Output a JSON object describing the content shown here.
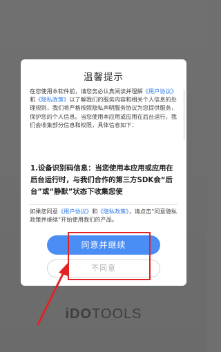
{
  "app": {
    "logo_mark": "iDO",
    "logo_rest": "TOOLS"
  },
  "dialog": {
    "title": "温馨提示",
    "intro": {
      "text_1": "在您使用本软件前，请您务必认真阅读并理解",
      "link_user_agreement": "《用户协议》",
      "text_2": "和",
      "link_privacy_policy": "《隐私政策》",
      "text_3": "以了解我们的服务内容和相关个人信息的处理规则，我们将严格按照隐私声明服务协议为您提供服务，保护您的个人信息。当您使用本应用或应用在后台运行，我们会收集部分信息和权限，具体信息如下："
    },
    "section_heading": "1.设备识别码信息：当您使用本应用或应用在后台运行时，与我们合作的第三方SDK会“后台”或“静默”状态下收集您使",
    "consent": {
      "text_1": "如果您同意",
      "link_user_agreement": "《用户协议》",
      "text_2": "和",
      "link_privacy_policy": "《隐私政策》",
      "text_3": "，请点击“同意隐私政策并继续”开始使用我们的产品。"
    },
    "agree_label": "同意并继续",
    "decline_label": "不同意"
  },
  "colors": {
    "accent": "#4a8ef5",
    "link": "#2f7be8",
    "annotation": "#e22323",
    "overlay": "#6f6f6f"
  }
}
